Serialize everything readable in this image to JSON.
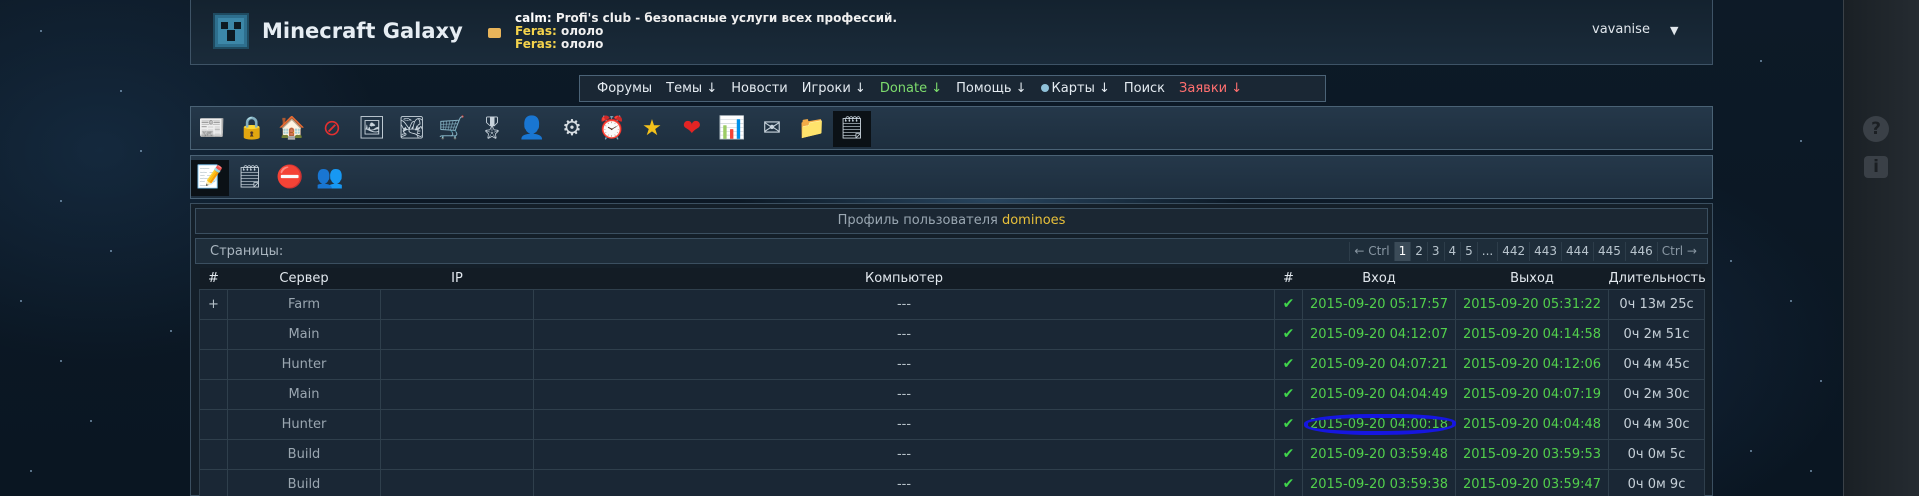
{
  "site": {
    "title": "Minecraft Galaxy"
  },
  "chat": [
    {
      "who": "calm:",
      "text": "Profi's club - безопасные услуги всех профессий."
    },
    {
      "who": "Feras:",
      "text": "ололо"
    },
    {
      "who": "Feras:",
      "text": "ололо"
    }
  ],
  "user": {
    "name": "vavanise",
    "caret": "▼"
  },
  "nav": [
    {
      "label": "Форумы"
    },
    {
      "label": "Темы ↓"
    },
    {
      "label": "Новости"
    },
    {
      "label": "Игроки ↓"
    },
    {
      "label": "Donate ↓"
    },
    {
      "label": "Помощь ↓"
    },
    {
      "label": "Карты ↓"
    },
    {
      "label": "Поиск"
    },
    {
      "label": "Заявки ↓"
    }
  ],
  "toolbar1_icons": [
    "news-icon",
    "lock-icon",
    "home-icon",
    "ban-icon",
    "picture-frame-icon",
    "image-icon",
    "cart-icon",
    "medal-icon",
    "user-icon",
    "gear-icon",
    "alarm-icon",
    "star-icon",
    "heart-icon",
    "chart-icon",
    "mail-icon",
    "folder-icon",
    "notepad-icon"
  ],
  "toolbar2_icons": [
    "edit-note-icon",
    "notepad-icon",
    "stop-icon",
    "users-icon"
  ],
  "profile": {
    "prefix": "Профиль пользователя",
    "username": "dominoes"
  },
  "pagination": {
    "label": "Страницы:",
    "prev": "← Ctrl",
    "pages": [
      "1",
      "2",
      "3",
      "4",
      "5",
      "...",
      "442",
      "443",
      "444",
      "445",
      "446"
    ],
    "current": "1",
    "next": "Ctrl →"
  },
  "table": {
    "columns": [
      "#",
      "Сервер",
      "IP",
      "Компьютер",
      "#",
      "Вход",
      "Выход",
      "Длительность"
    ],
    "rows": [
      {
        "num": "+",
        "server": "Farm",
        "ip": "",
        "computer": "---",
        "status": "✔",
        "login": "2015-09-20 05:17:57",
        "logout": "2015-09-20 05:31:22",
        "duration": "0ч 13м 25с"
      },
      {
        "num": "",
        "server": "Main",
        "ip": "",
        "computer": "---",
        "status": "✔",
        "login": "2015-09-20 04:12:07",
        "logout": "2015-09-20 04:14:58",
        "duration": "0ч 2м 51с"
      },
      {
        "num": "",
        "server": "Hunter",
        "ip": "",
        "computer": "---",
        "status": "✔",
        "login": "2015-09-20 04:07:21",
        "logout": "2015-09-20 04:12:06",
        "duration": "0ч 4м 45с"
      },
      {
        "num": "",
        "server": "Main",
        "ip": "",
        "computer": "---",
        "status": "✔",
        "login": "2015-09-20 04:04:49",
        "logout": "2015-09-20 04:07:19",
        "duration": "0ч 2м 30с"
      },
      {
        "num": "",
        "server": "Hunter",
        "ip": "",
        "computer": "---",
        "status": "✔",
        "login": "2015-09-20 04:00:18",
        "logout": "2015-09-20 04:04:48",
        "duration": "0ч 4м 30с",
        "highlighted": true
      },
      {
        "num": "",
        "server": "Build",
        "ip": "",
        "computer": "---",
        "status": "✔",
        "login": "2015-09-20 03:59:48",
        "logout": "2015-09-20 03:59:53",
        "duration": "0ч 0м 5с"
      },
      {
        "num": "",
        "server": "Build",
        "ip": "",
        "computer": "---",
        "status": "✔",
        "login": "2015-09-20 03:59:38",
        "logout": "2015-09-20 03:59:47",
        "duration": "0ч 0м 9с"
      }
    ]
  },
  "side_buttons": {
    "help": "?",
    "info": "i"
  },
  "colors": {
    "accent_green": "#52d04c",
    "username_gold": "#e8c03a",
    "donate": "#7ddc6d",
    "requests": "#ff6f6f",
    "highlight": "#1616e0"
  }
}
